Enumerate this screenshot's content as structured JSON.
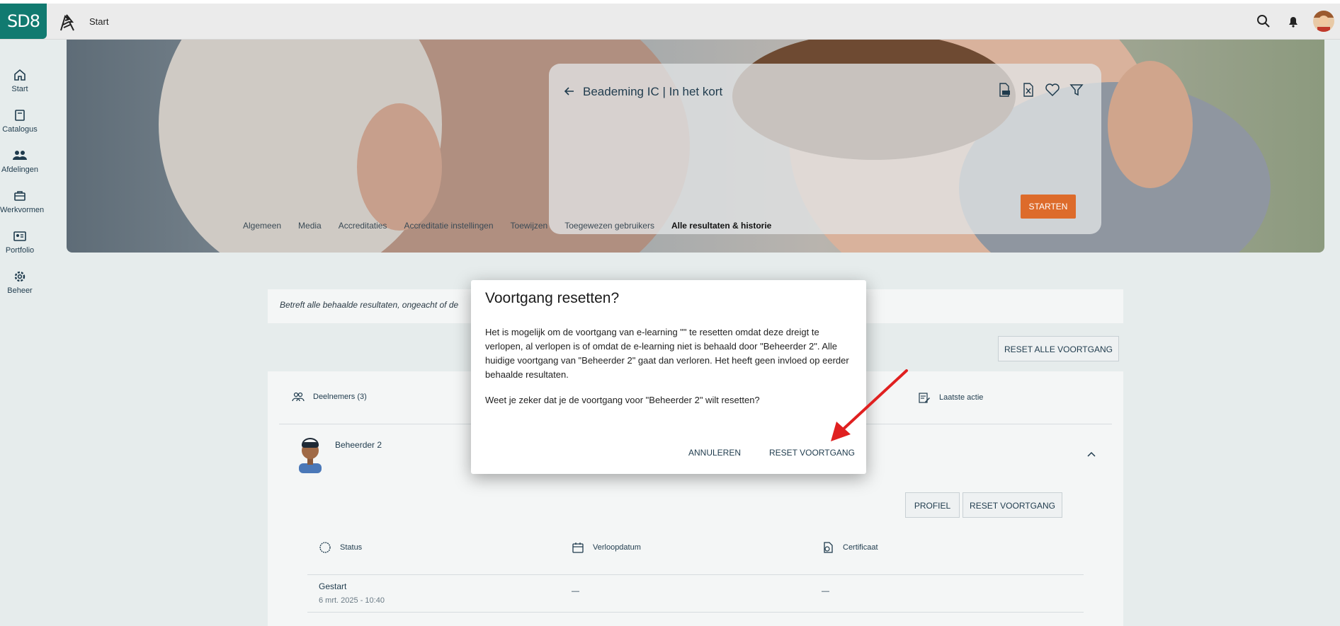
{
  "header": {
    "logo": "SD8",
    "breadcrumb": "Start"
  },
  "sidebar": {
    "items": [
      {
        "label": "Start",
        "icon": "home-icon"
      },
      {
        "label": "Catalogus",
        "icon": "book-icon"
      },
      {
        "label": "Afdelingen",
        "icon": "users-icon"
      },
      {
        "label": "Werkvormen",
        "icon": "briefcase-icon"
      },
      {
        "label": "Portfolio",
        "icon": "id-card-icon"
      },
      {
        "label": "Beheer",
        "icon": "gear-icon"
      }
    ]
  },
  "course": {
    "title": "Beademing IC | In het kort",
    "start_label": "STARTEN"
  },
  "tabs": [
    {
      "label": "Algemeen"
    },
    {
      "label": "Media"
    },
    {
      "label": "Accreditaties"
    },
    {
      "label": "Accreditatie instellingen"
    },
    {
      "label": "Toewijzen"
    },
    {
      "label": "Toegewezen gebruikers"
    },
    {
      "label": "Alle resultaten & historie",
      "active": true
    }
  ],
  "info_text": "Betreft alle behaalde resultaten, ongeacht of de",
  "reset_all_label": "RESET ALLE VOORTGANG",
  "table": {
    "participants_label": "Deelnemers (3)",
    "last_action_label": "Laatste actie",
    "user_name": "Beheerder 2",
    "profile_label": "PROFIEL",
    "reset_label": "RESET VOORTGANG",
    "columns": {
      "status": "Status",
      "expiry": "Verloopdatum",
      "certificate": "Certificaat"
    },
    "row": {
      "status": "Gestart",
      "date": "6 mrt. 2025 - 10:40",
      "expiry": "—",
      "certificate": "—"
    }
  },
  "dialog": {
    "title": "Voortgang resetten?",
    "body1": "Het is mogelijk om de voortgang van e-learning \"\" te resetten omdat deze dreigt te verlopen, al verlopen is of omdat de e-learning niet is behaald door \"Beheerder 2\". Alle huidige voortgang van \"Beheerder 2\" gaat dan verloren. Het heeft geen invloed op eerder behaalde resultaten.",
    "body2": "Weet je zeker dat je de voortgang voor \"Beheerder 2\" wilt resetten?",
    "cancel_label": "ANNULEREN",
    "confirm_label": "RESET VOORTGANG"
  },
  "colors": {
    "brand": "#117a70",
    "accent": "#dd6b2b",
    "annotation_arrow": "#e02020"
  }
}
